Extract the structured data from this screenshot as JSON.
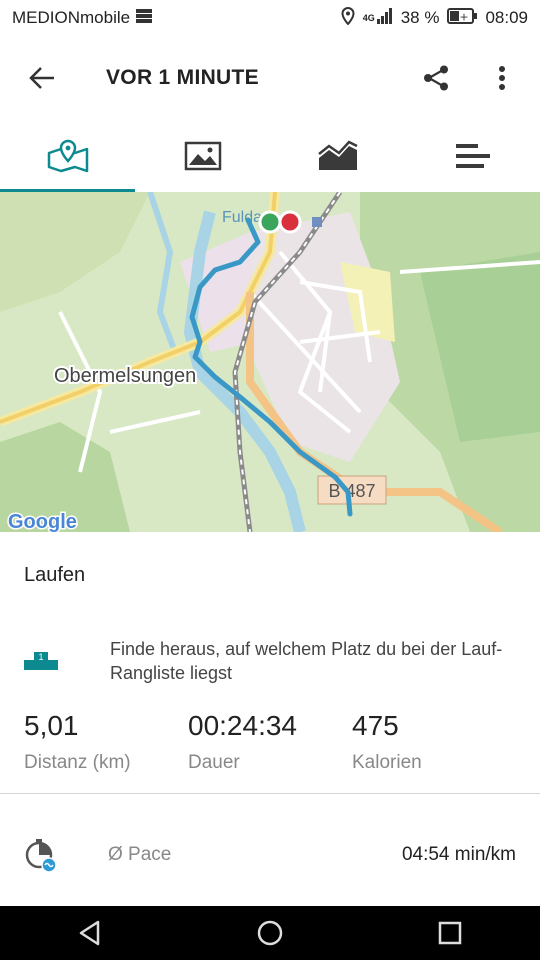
{
  "status_bar": {
    "carrier": "MEDIONmobile",
    "network": "4G",
    "battery": "38 %",
    "time": "08:09"
  },
  "header": {
    "title": "VOR 1 MINUTE"
  },
  "tabs": [
    {
      "name": "map",
      "icon": "map-pin-icon",
      "active": true
    },
    {
      "name": "photos",
      "icon": "image-icon",
      "active": false
    },
    {
      "name": "graphs",
      "icon": "chart-area-icon",
      "active": false
    },
    {
      "name": "details",
      "icon": "list-icon",
      "active": false
    }
  ],
  "map": {
    "place_label": "Obermelsungen",
    "road_label": "B 487",
    "river_label": "Fulda",
    "attribution": "Google"
  },
  "activity": {
    "type": "Laufen"
  },
  "ranking": {
    "badge": "1",
    "text": "Finde heraus, auf welchem Platz du bei der Lauf-Rangliste liegst"
  },
  "stats": {
    "distance_value": "5,01",
    "distance_label": "Distanz (km)",
    "duration_value": "00:24:34",
    "duration_label": "Dauer",
    "calories_value": "475",
    "calories_label": "Kalorien"
  },
  "pace": {
    "label": "Ø Pace",
    "value": "04:54 min/km"
  },
  "colors": {
    "accent": "#0d8a8f",
    "route": "#3a98c6",
    "start_marker": "#3aa55b",
    "end_marker": "#d9303e"
  }
}
